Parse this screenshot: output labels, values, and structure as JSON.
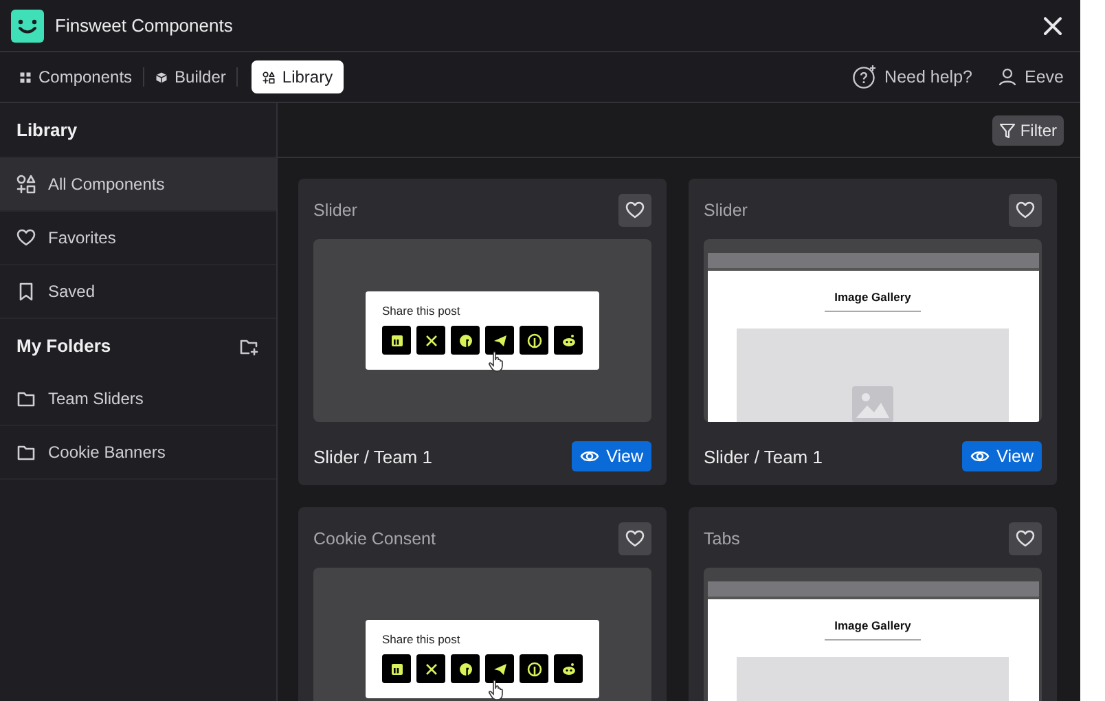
{
  "window": {
    "title": "Finsweet Components"
  },
  "nav": {
    "tabs": [
      {
        "label": "Components",
        "selected": false
      },
      {
        "label": "Builder",
        "selected": false
      },
      {
        "label": "Library",
        "selected": true
      }
    ],
    "help": "Need help?",
    "user": "Eeve"
  },
  "sidebar": {
    "title": "Library",
    "items": [
      {
        "label": "All Components",
        "selected": true
      },
      {
        "label": "Favorites",
        "selected": false
      },
      {
        "label": "Saved",
        "selected": false
      }
    ],
    "folders_title": "My Folders",
    "folders": [
      {
        "label": "Team Sliders",
        "selected": false
      },
      {
        "label": "Cookie Banners",
        "selected": false
      }
    ]
  },
  "toolbar": {
    "filter": "Filter"
  },
  "cards": [
    {
      "title": "Slider",
      "preview": {
        "kind": "share",
        "heading": "Share this post"
      },
      "name": "Slider / Team 1",
      "view": "View"
    },
    {
      "title": "Slider",
      "preview": {
        "kind": "gallery",
        "heading": "Image Gallery",
        "image_icon": true
      },
      "name": "Slider / Team 1",
      "view": "View"
    },
    {
      "title": "Cookie Consent",
      "preview": {
        "kind": "share",
        "heading": "Share this post"
      }
    },
    {
      "title": "Tabs",
      "preview": {
        "kind": "gallery",
        "heading": "Image Gallery"
      }
    }
  ]
}
